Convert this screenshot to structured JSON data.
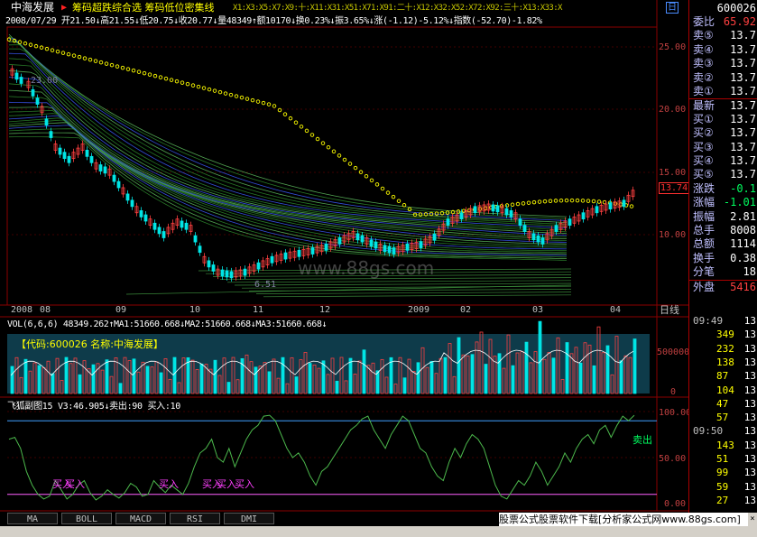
{
  "header": {
    "stock_name": "中海发展",
    "indicator_title": "筹码超跌综合选 筹码低位密集线",
    "ma_list": "X1:X3:X5:X7:X9:十:X11:X31:X51:X71:X91:二十:X12:X32:X52:X72:X92:三十:X13:X33:X",
    "icon_label": "日",
    "info_line": "2008/07/29 开21.50↓高21.55↓低20.75↓收20.77↓量48349↑额10170↓换0.23%↓振3.65%↓涨(-1.12)-5.12%↓指数(-52.70)-1.82%"
  },
  "price_chart": {
    "y_labels": [
      "25.00",
      "20.00",
      "15.00",
      "10.00"
    ],
    "current_price": "13.74",
    "high_label": "23.00",
    "low_label": "6.51",
    "watermark": "www.88gs.com",
    "x_labels": [
      "2008",
      "08",
      "09",
      "10",
      "11",
      "12",
      "2009",
      "02",
      "03",
      "04"
    ],
    "period_label": "日线"
  },
  "volume": {
    "header": "VOL(6,6,6) 48349.262↑MA1:51660.668↓MA2:51660.668↓MA3:51660.668↓",
    "code_label": "【代码:600026 名称:中海发展】",
    "y_labels": [
      "500000",
      "0"
    ]
  },
  "indicator": {
    "header": "飞狐副图15 V3:46.905↓卖出:90 买入:10",
    "y_labels": [
      "100.00",
      "50.00",
      "0.00"
    ],
    "sell_label": "卖出",
    "buy_labels": [
      "买入",
      "买入",
      "买入",
      "买入",
      "买入",
      "买入"
    ]
  },
  "quote_panel": {
    "code": "600026",
    "rows": [
      {
        "label": "委比",
        "value": "65.92"
      },
      {
        "label": "卖⑤",
        "value": "13.7"
      },
      {
        "label": "卖④",
        "value": "13.7"
      },
      {
        "label": "卖③",
        "value": "13.7"
      },
      {
        "label": "卖②",
        "value": "13.7"
      },
      {
        "label": "卖①",
        "value": "13.7"
      },
      {
        "label": "最新",
        "value": "13.7"
      },
      {
        "label": "买①",
        "value": "13.7"
      },
      {
        "label": "买②",
        "value": "13.7"
      },
      {
        "label": "买③",
        "value": "13.7"
      },
      {
        "label": "买④",
        "value": "13.7"
      },
      {
        "label": "买⑤",
        "value": "13.7"
      },
      {
        "label": "涨跌",
        "value": "-0.1"
      },
      {
        "label": "涨幅",
        "value": "-1.01"
      },
      {
        "label": "振幅",
        "value": "2.81"
      },
      {
        "label": "总手",
        "value": "8008"
      },
      {
        "label": "总额",
        "value": "1114"
      },
      {
        "label": "换手",
        "value": "0.38"
      },
      {
        "label": "分笔",
        "value": "18"
      },
      {
        "label": "外盘",
        "value": "5416"
      }
    ],
    "ticks": [
      {
        "time": "09:49",
        "value": "13"
      },
      {
        "time": "",
        "value": "13"
      },
      {
        "time": "",
        "value": "13"
      },
      {
        "time": "",
        "value": "13"
      },
      {
        "time": "",
        "value": "13"
      },
      {
        "time": "",
        "value": "13"
      },
      {
        "time": "",
        "value": "13"
      },
      {
        "time": "",
        "value": "13"
      },
      {
        "time": "09:50",
        "value": "13"
      },
      {
        "time": "",
        "value": "13"
      },
      {
        "time": "",
        "value": "13"
      },
      {
        "time": "",
        "value": "13"
      },
      {
        "time": "",
        "value": "13"
      },
      {
        "time": "",
        "value": "13"
      }
    ],
    "tick_vols": [
      "",
      "349",
      "232",
      "138",
      "87",
      "104",
      "47",
      "57",
      "",
      "143",
      "51",
      "99",
      "59",
      "27"
    ]
  },
  "tabs": [
    "MA",
    "BOLL",
    "MACD",
    "RSI",
    "DMI"
  ],
  "banner": "股票公式股票软件下载[分析家公式网www.88gs.com]",
  "colors": {
    "up": "#ff4040",
    "down": "#00e5e5",
    "ma_green": "#2e8b2e",
    "ma_blue": "#3c5cff",
    "dot_yellow": "#ffff00",
    "grid": "#8b0000",
    "volume_bg": "#0e3b4a",
    "text_yellow": "#ffff00",
    "text_white": "#ffffff"
  }
}
